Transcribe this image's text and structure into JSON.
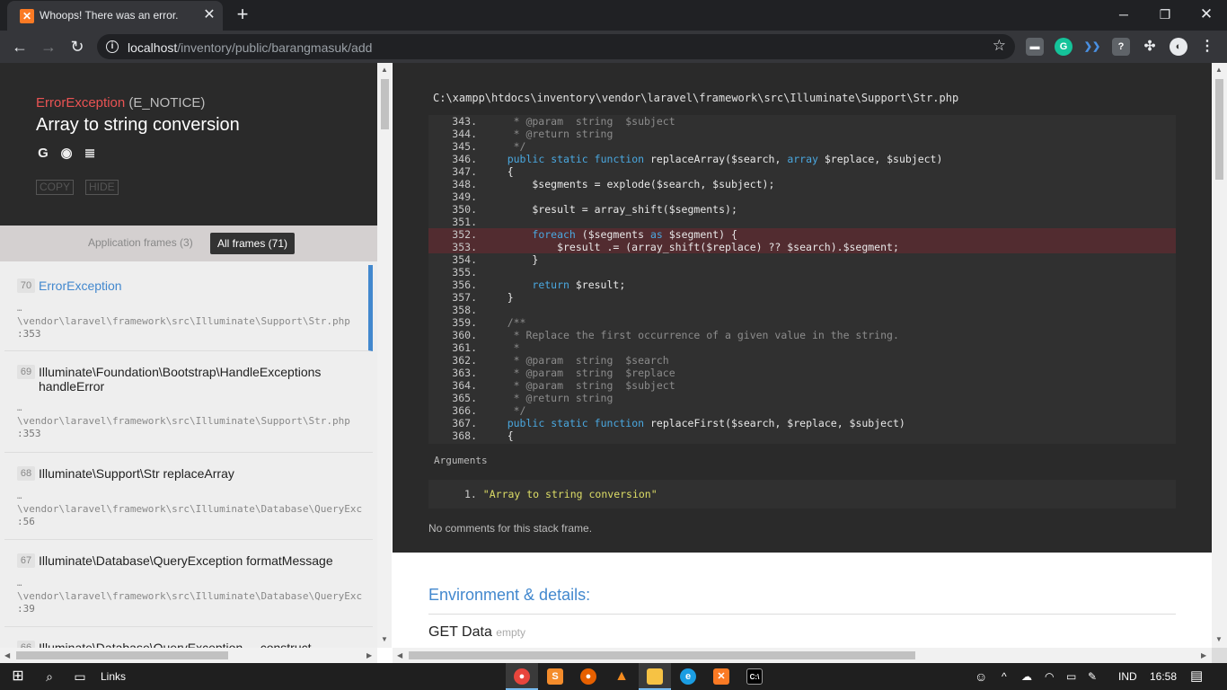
{
  "browser": {
    "tab_title": "Whoops! There was an error.",
    "tab_favicon": "xampp-icon",
    "url_host": "localhost",
    "url_path": "/inventory/public/barangmasuk/add"
  },
  "exception": {
    "class": "ErrorException",
    "type": "(E_NOTICE)",
    "message": "Array to string conversion",
    "copy_label": "COPY",
    "hide_label": "HIDE"
  },
  "frames_filter": {
    "application": "Application frames (3)",
    "all": "All frames (71)"
  },
  "frames": [
    {
      "index": "70",
      "class_line1": "ErrorException",
      "class_line2": "",
      "dots": "…",
      "file": "\\vendor\\laravel\\framework\\src\\Illuminate\\Support\\Str.php",
      "line": ":353"
    },
    {
      "index": "69",
      "class_line1": "Illuminate\\Foundation\\Bootstrap\\HandleExceptions",
      "class_line2": "handleError",
      "dots": "…",
      "file": "\\vendor\\laravel\\framework\\src\\Illuminate\\Support\\Str.php",
      "line": ":353"
    },
    {
      "index": "68",
      "class_line1": "Illuminate\\Support\\Str replaceArray",
      "class_line2": "",
      "dots": "…",
      "file": "\\vendor\\laravel\\framework\\src\\Illuminate\\Database\\QueryExc",
      "line": ":56"
    },
    {
      "index": "67",
      "class_line1": "Illuminate\\Database\\QueryException formatMessage",
      "class_line2": "",
      "dots": "…",
      "file": "\\vendor\\laravel\\framework\\src\\Illuminate\\Database\\QueryExc",
      "line": ":39"
    },
    {
      "index": "66",
      "class_line1": "Illuminate\\Database\\QueryException __construct",
      "class_line2": "",
      "dots": "",
      "file": "",
      "line": ""
    }
  ],
  "code": {
    "file_path": "C:\\xampp\\htdocs\\inventory\\vendor\\laravel\\framework\\src\\Illuminate\\Support\\Str.php",
    "lines": [
      {
        "n": "343.",
        "src": "     * @param  string  $subject",
        "kind": "comment"
      },
      {
        "n": "344.",
        "src": "     * @return string",
        "kind": "comment"
      },
      {
        "n": "345.",
        "src": "     */",
        "kind": "comment"
      },
      {
        "n": "346.",
        "src": "    public static function replaceArray($search, array $replace, $subject)",
        "kind": "code"
      },
      {
        "n": "347.",
        "src": "    {",
        "kind": "code"
      },
      {
        "n": "348.",
        "src": "        $segments = explode($search, $subject);",
        "kind": "code"
      },
      {
        "n": "349.",
        "src": "",
        "kind": "code"
      },
      {
        "n": "350.",
        "src": "        $result = array_shift($segments);",
        "kind": "code"
      },
      {
        "n": "351.",
        "src": "",
        "kind": "code"
      },
      {
        "n": "352.",
        "src": "        foreach ($segments as $segment) {",
        "kind": "code"
      },
      {
        "n": "353.",
        "src": "            $result .= (array_shift($replace) ?? $search).$segment;",
        "kind": "code"
      },
      {
        "n": "354.",
        "src": "        }",
        "kind": "code"
      },
      {
        "n": "355.",
        "src": "",
        "kind": "code"
      },
      {
        "n": "356.",
        "src": "        return $result;",
        "kind": "code"
      },
      {
        "n": "357.",
        "src": "    }",
        "kind": "code"
      },
      {
        "n": "358.",
        "src": "",
        "kind": "code"
      },
      {
        "n": "359.",
        "src": "    /**",
        "kind": "comment"
      },
      {
        "n": "360.",
        "src": "     * Replace the first occurrence of a given value in the string.",
        "kind": "comment"
      },
      {
        "n": "361.",
        "src": "     *",
        "kind": "comment"
      },
      {
        "n": "362.",
        "src": "     * @param  string  $search",
        "kind": "comment"
      },
      {
        "n": "363.",
        "src": "     * @param  string  $replace",
        "kind": "comment"
      },
      {
        "n": "364.",
        "src": "     * @param  string  $subject",
        "kind": "comment"
      },
      {
        "n": "365.",
        "src": "     * @return string",
        "kind": "comment"
      },
      {
        "n": "366.",
        "src": "     */",
        "kind": "comment"
      },
      {
        "n": "367.",
        "src": "    public static function replaceFirst($search, $replace, $subject)",
        "kind": "code"
      },
      {
        "n": "368.",
        "src": "    {",
        "kind": "code"
      }
    ],
    "highlight_lines": [
      "352.",
      "353."
    ]
  },
  "arguments": {
    "title": "Arguments",
    "item_number": "1.",
    "item_value": "\"Array to string conversion\""
  },
  "no_comments": "No comments for this stack frame.",
  "env": {
    "title": "Environment & details:",
    "get_data": "GET Data",
    "get_empty": "empty"
  },
  "taskbar": {
    "search_label": "Links",
    "lang": "IND",
    "time": "16:58"
  },
  "colors": {
    "error_red": "#e95353",
    "accent_blue": "#4288ce",
    "code_bg": "#303030",
    "highlight_bg": "#522c30",
    "keyword": "#4aa8e0"
  }
}
